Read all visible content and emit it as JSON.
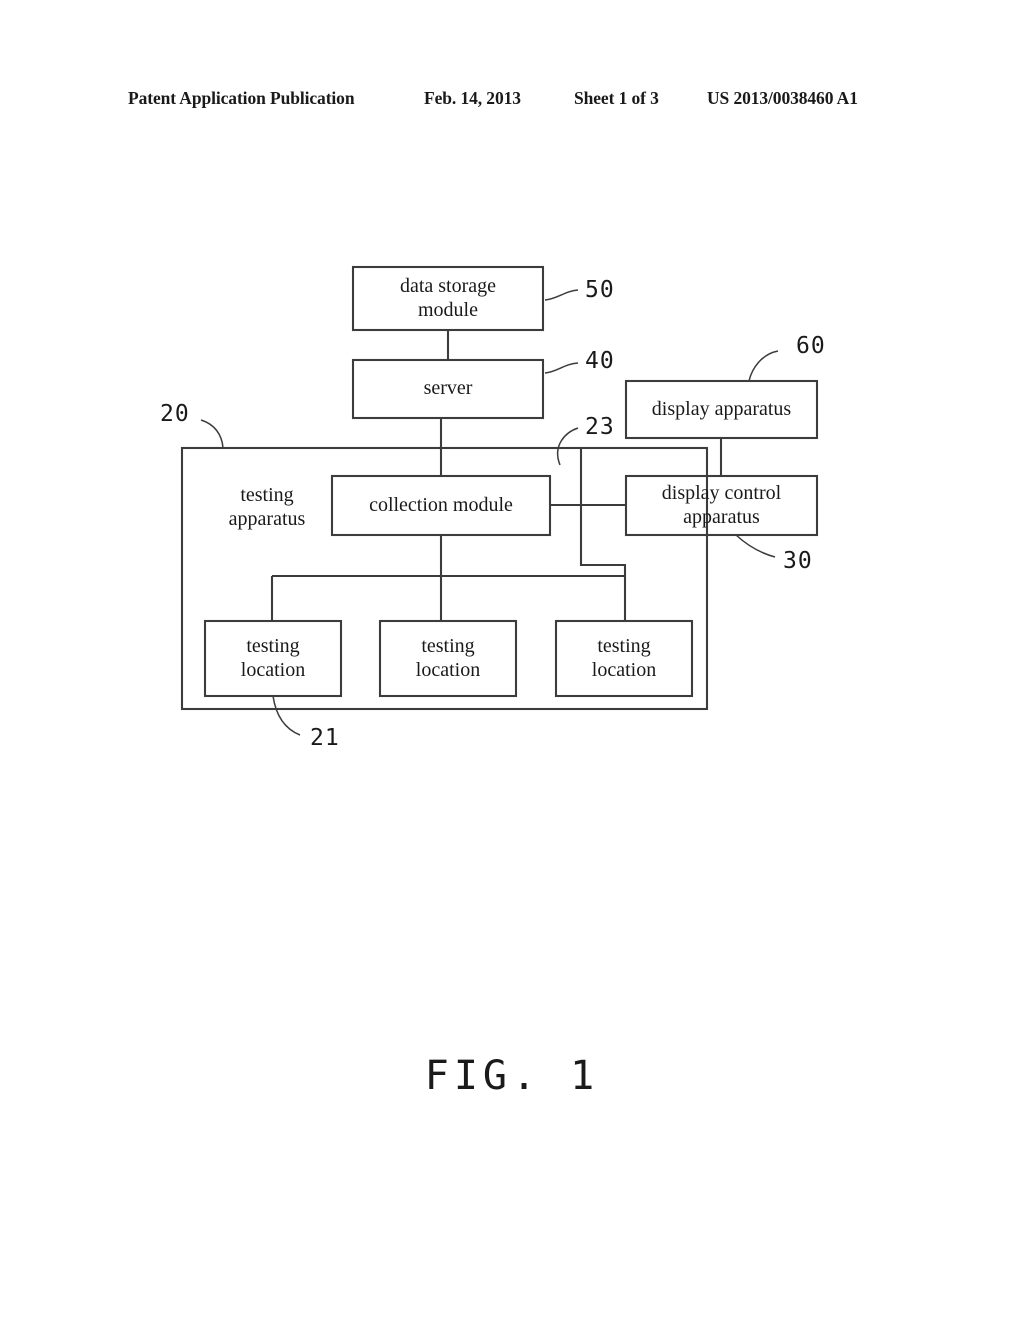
{
  "header": {
    "publication": "Patent Application Publication",
    "date": "Feb. 14, 2013",
    "sheet": "Sheet 1 of 3",
    "patent_number": "US 2013/0038460 A1"
  },
  "figure": {
    "caption": "FIG. 1",
    "boxes": {
      "data_storage_module": "data storage\nmodule",
      "server": "server",
      "display_apparatus": "display apparatus",
      "display_control_apparatus": "display control\napparatus",
      "collection_module": "collection module",
      "testing_location_1": "testing\nlocation",
      "testing_location_2": "testing\nlocation",
      "testing_location_3": "testing\nlocation"
    },
    "labels": {
      "testing_apparatus": "testing\napparatus"
    },
    "reference_numerals": {
      "testing_apparatus": "20",
      "testing_location": "21",
      "collection_module": "23",
      "display_control_apparatus": "30",
      "server": "40",
      "data_storage_module": "50",
      "display_apparatus": "60"
    }
  },
  "style": {
    "line_color": "#3c3c3c",
    "text_color": "#1a1a1a",
    "background": "#ffffff"
  }
}
